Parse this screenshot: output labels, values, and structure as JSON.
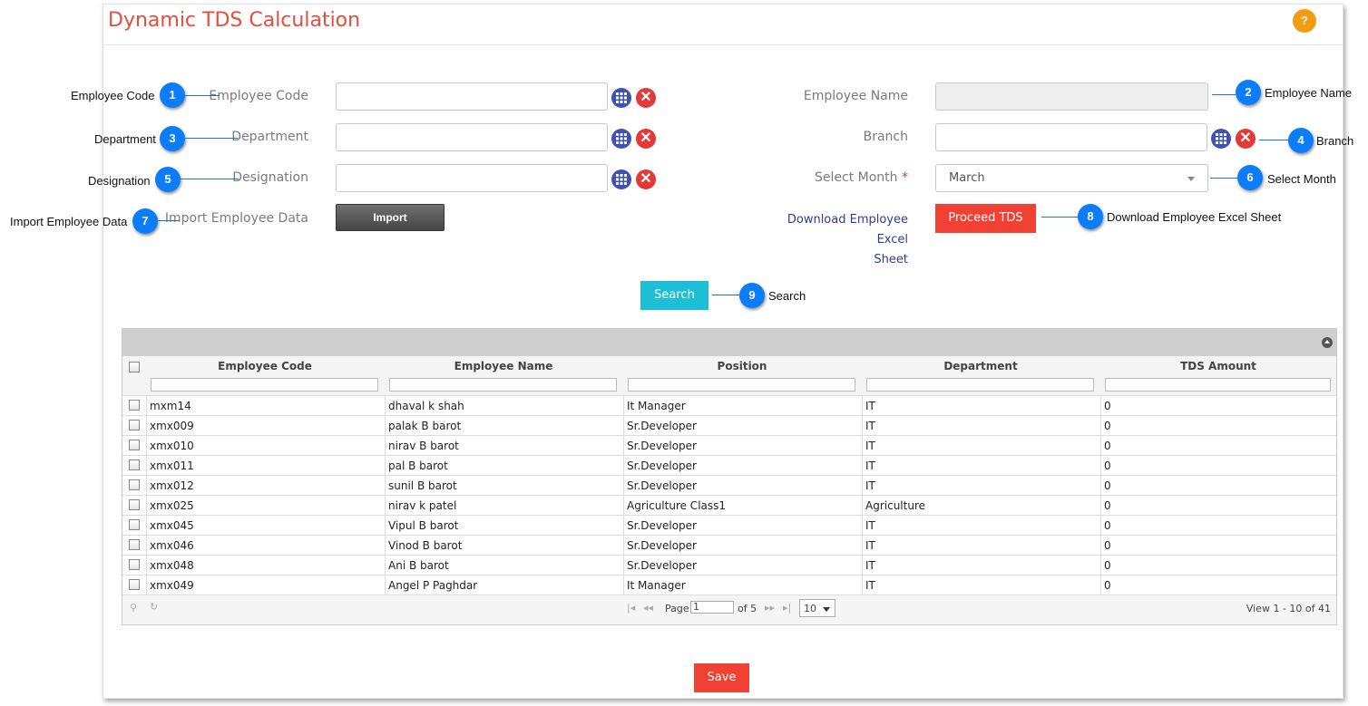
{
  "page": {
    "title": "Dynamic TDS Calculation",
    "help_label": "?"
  },
  "form": {
    "employee_code_label": "Employee Code",
    "employee_name_label": "Employee Name",
    "department_label": "Department",
    "branch_label": "Branch",
    "designation_label": "Designation",
    "select_month_label": "Select Month",
    "required_mark": "*",
    "select_month_value": "March",
    "import_label": "Import Employee Data",
    "import_button": "Import",
    "download_link_line1": "Download Employee Excel",
    "download_link_line2": "Sheet",
    "proceed_button": "Proceed TDS",
    "search_button": "Search",
    "save_button": "Save",
    "clear_glyph": "✕"
  },
  "callouts": [
    {
      "num": "1",
      "text": "Employee Code"
    },
    {
      "num": "2",
      "text": "Employee Name"
    },
    {
      "num": "3",
      "text": "Department"
    },
    {
      "num": "4",
      "text": "Branch"
    },
    {
      "num": "5",
      "text": "Designation"
    },
    {
      "num": "6",
      "text": "Select Month"
    },
    {
      "num": "7",
      "text": "Import Employee Data"
    },
    {
      "num": "8",
      "text": "Download Employee Excel Sheet"
    },
    {
      "num": "9",
      "text": "Search"
    }
  ],
  "grid": {
    "columns": [
      "Employee Code",
      "Employee Name",
      "Position",
      "Department",
      "TDS Amount"
    ],
    "rows": [
      [
        "mxm14",
        "dhaval k shah",
        "It Manager",
        "IT",
        "0"
      ],
      [
        "xmx009",
        "palak B barot",
        "Sr.Developer",
        "IT",
        "0"
      ],
      [
        "xmx010",
        "nirav B barot",
        "Sr.Developer",
        "IT",
        "0"
      ],
      [
        "xmx011",
        "pal B barot",
        "Sr.Developer",
        "IT",
        "0"
      ],
      [
        "xmx012",
        "sunil B barot",
        "Sr.Developer",
        "IT",
        "0"
      ],
      [
        "xmx025",
        "nirav k patel",
        "Agriculture Class1",
        "Agriculture",
        "0"
      ],
      [
        "xmx045",
        "Vipul B barot",
        "Sr.Developer",
        "IT",
        "0"
      ],
      [
        "xmx046",
        "Vinod B barot",
        "Sr.Developer",
        "IT",
        "0"
      ],
      [
        "xmx048",
        "Ani B barot",
        "Sr.Developer",
        "IT",
        "0"
      ],
      [
        "xmx049",
        "Angel P Paghdar",
        "It Manager",
        "IT",
        "0"
      ]
    ],
    "pager": {
      "page_label": "Page",
      "page_value": "1",
      "of_label": "of 5",
      "page_size": "10",
      "view_text": "View 1 - 10 of 41"
    }
  },
  "colors": {
    "accent_red": "#f04134",
    "title_red": "#e84c3d",
    "callout_blue": "#0b7dfa",
    "search_cyan": "#1ebfd6",
    "grid_button_indigo": "#3f51b5"
  }
}
